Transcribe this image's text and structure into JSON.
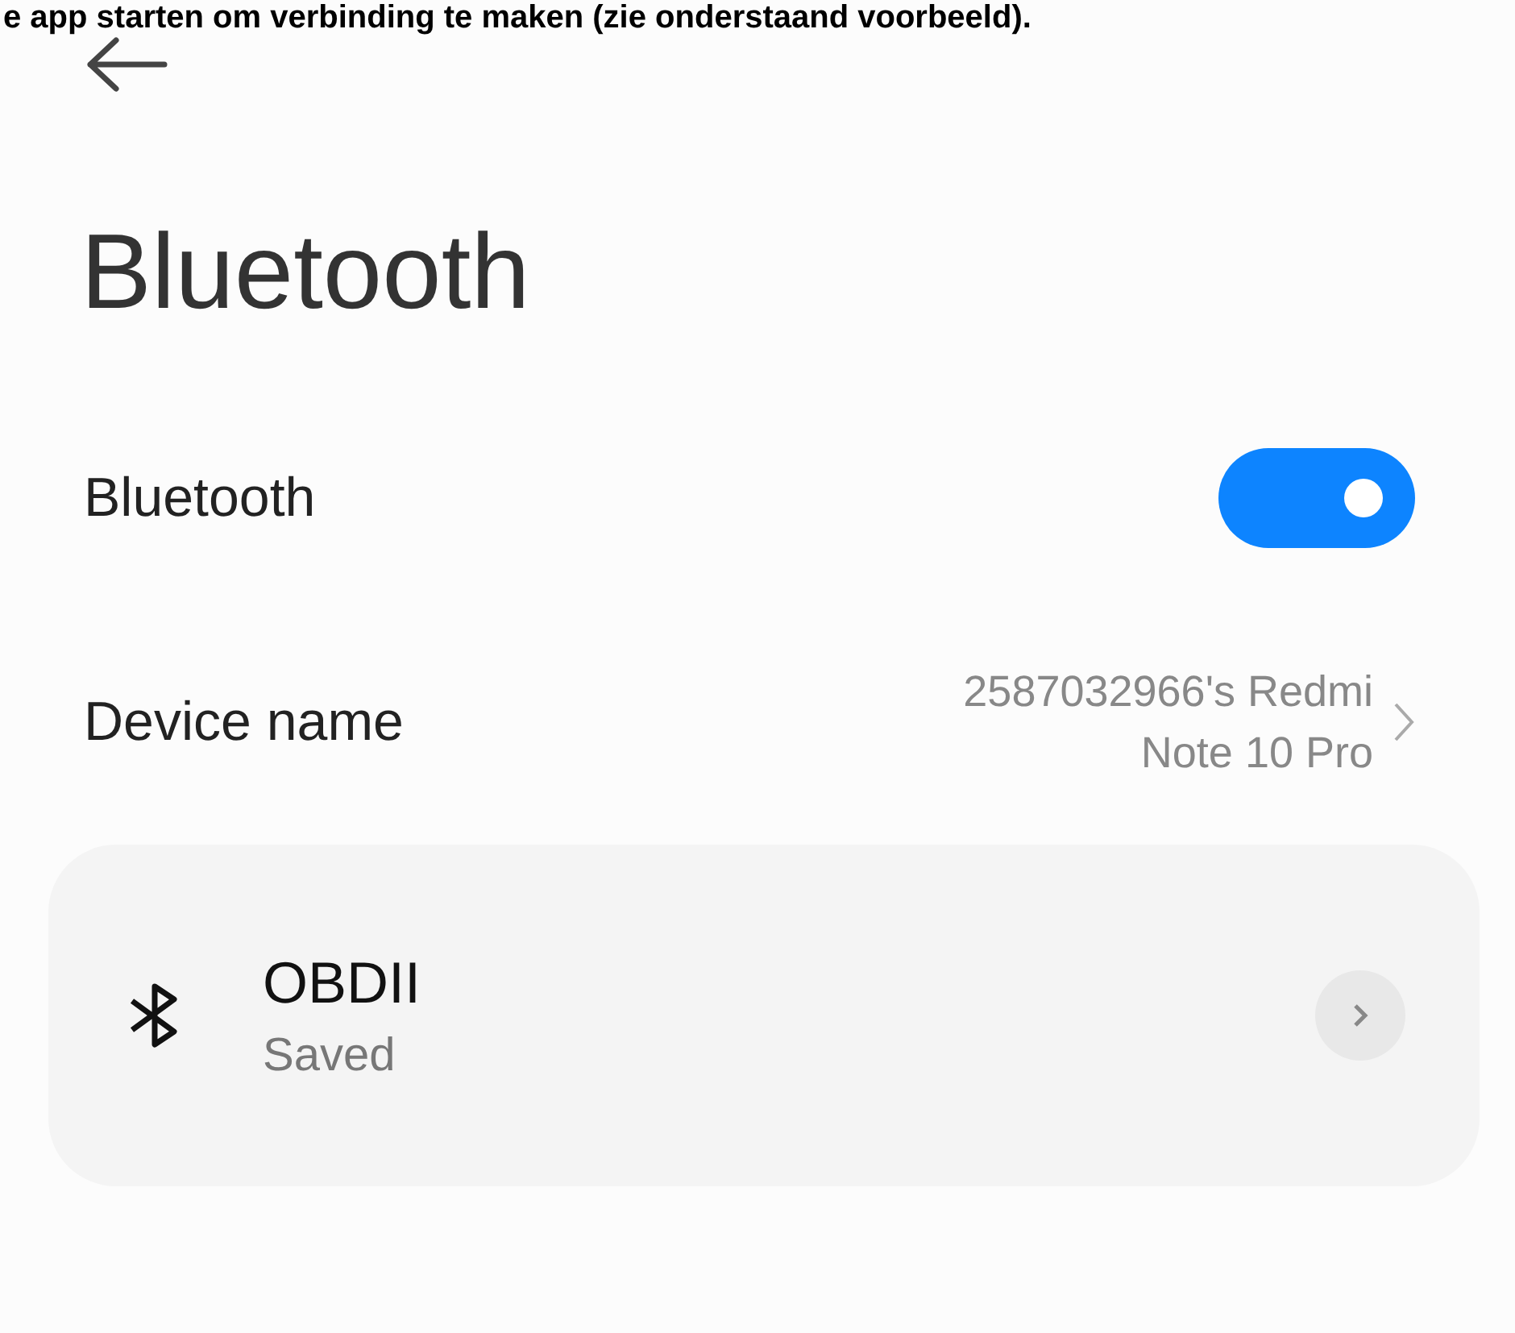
{
  "caption": "e app starten om verbinding te maken (zie onderstaand voorbeeld).",
  "header": {
    "title": "Bluetooth"
  },
  "bluetooth": {
    "label": "Bluetooth",
    "on": true
  },
  "device_name": {
    "label": "Device name",
    "value": "2587032966's Redmi Note 10 Pro"
  },
  "devices": [
    {
      "name": "OBDII",
      "status": "Saved"
    }
  ]
}
